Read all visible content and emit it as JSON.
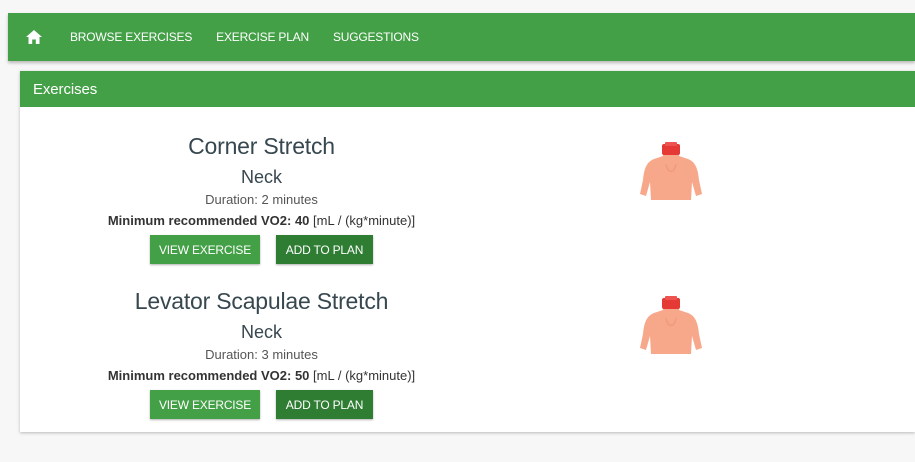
{
  "nav": {
    "home_icon": "home-icon",
    "items": [
      "BROWSE EXERCISES",
      "EXERCISE PLAN",
      "SUGGESTIONS"
    ]
  },
  "card": {
    "title": "Exercises"
  },
  "exercises": [
    {
      "name": "Corner Stretch",
      "area": "Neck",
      "duration": "Duration: 2 minutes",
      "vo2_label": "Minimum recommended VO2:",
      "vo2_value": "40",
      "vo2_unit": "[mL / (kg*minute)]",
      "view_label": "VIEW EXERCISE",
      "add_label": "ADD TO PLAN",
      "image_icon": "torso-neck-highlight-icon"
    },
    {
      "name": "Levator Scapulae Stretch",
      "area": "Neck",
      "duration": "Duration: 3 minutes",
      "vo2_label": "Minimum recommended VO2:",
      "vo2_value": "50",
      "vo2_unit": "[mL / (kg*minute)]",
      "view_label": "VIEW EXERCISE",
      "add_label": "ADD TO PLAN",
      "image_icon": "torso-neck-highlight-icon"
    }
  ],
  "colors": {
    "brand_green": "#43a047",
    "dark_green": "#2e7d32",
    "highlight_red": "#e53935",
    "skin": "#f8a88a"
  }
}
